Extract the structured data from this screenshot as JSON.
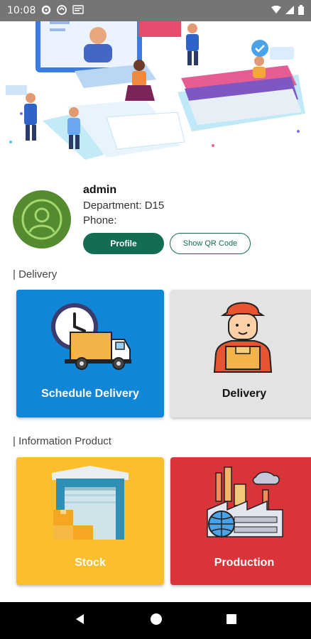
{
  "status_bar": {
    "time": "10:08",
    "left_icons": [
      "settings-icon",
      "notification-icon",
      "card-icon"
    ],
    "right_icons": [
      "wifi-icon",
      "signal-icon",
      "battery-icon"
    ]
  },
  "hero": {
    "illustration": "online-learning-illustration"
  },
  "profile": {
    "name": "admin",
    "department": "Department: D15",
    "phone": "Phone:",
    "avatar_icon": "user-icon",
    "profile_button": "Profile",
    "qr_button": "Show QR Code"
  },
  "sections": {
    "delivery_title": "| Delivery",
    "info_title": "| Information Product"
  },
  "tiles": {
    "schedule_delivery": "Schedule Delivery",
    "delivery": "Delivery",
    "stock": "Stock",
    "production": "Production"
  },
  "colors": {
    "primary": "#136d55",
    "schedule_delivery_bg": "#1185d6",
    "delivery_bg": "#e3e3e3",
    "stock_bg": "#fbbf2d",
    "production_bg": "#d8343a",
    "avatar_bg": "#558b2f"
  },
  "nav_bar": {
    "icons": [
      "back-icon",
      "home-icon",
      "recents-icon"
    ]
  }
}
